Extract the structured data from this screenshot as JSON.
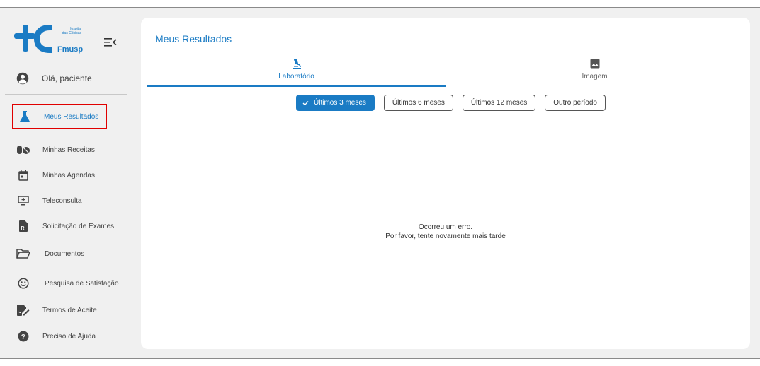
{
  "brand": {
    "logo_line1": "Hospital",
    "logo_line2": "das Clínicas",
    "logo_name": "Fmusp",
    "primary_color": "#1a7bc4"
  },
  "user": {
    "greeting": "Olá, paciente"
  },
  "sidebar": {
    "items": [
      {
        "label": "Meus Resultados",
        "icon": "flask-icon",
        "active": true
      },
      {
        "label": "Minhas Receitas",
        "icon": "pills-icon"
      },
      {
        "label": "Minhas Agendas",
        "icon": "calendar-icon"
      },
      {
        "label": "Teleconsulta",
        "icon": "monitor-plus-icon"
      },
      {
        "label": "Solicitação de Exames",
        "icon": "prescription-icon"
      },
      {
        "label": "Documentos",
        "icon": "folder-open-icon"
      },
      {
        "label": "Pesquisa de Satisfação",
        "icon": "smiley-icon"
      },
      {
        "label": "Termos de Aceite",
        "icon": "signature-icon"
      },
      {
        "label": "Preciso de Ajuda",
        "icon": "help-icon"
      }
    ]
  },
  "main": {
    "title": "Meus Resultados",
    "tabs": [
      {
        "label": "Laboratório",
        "icon": "microscope-icon",
        "active": true
      },
      {
        "label": "Imagem",
        "icon": "image-icon"
      }
    ],
    "filters": [
      {
        "label": "Últimos 3 meses",
        "selected": true
      },
      {
        "label": "Últimos 6 meses"
      },
      {
        "label": "Últimos 12 meses"
      },
      {
        "label": "Outro período"
      }
    ],
    "error_line1": "Ocorreu um erro.",
    "error_line2": "Por favor, tente novamente mais tarde"
  }
}
